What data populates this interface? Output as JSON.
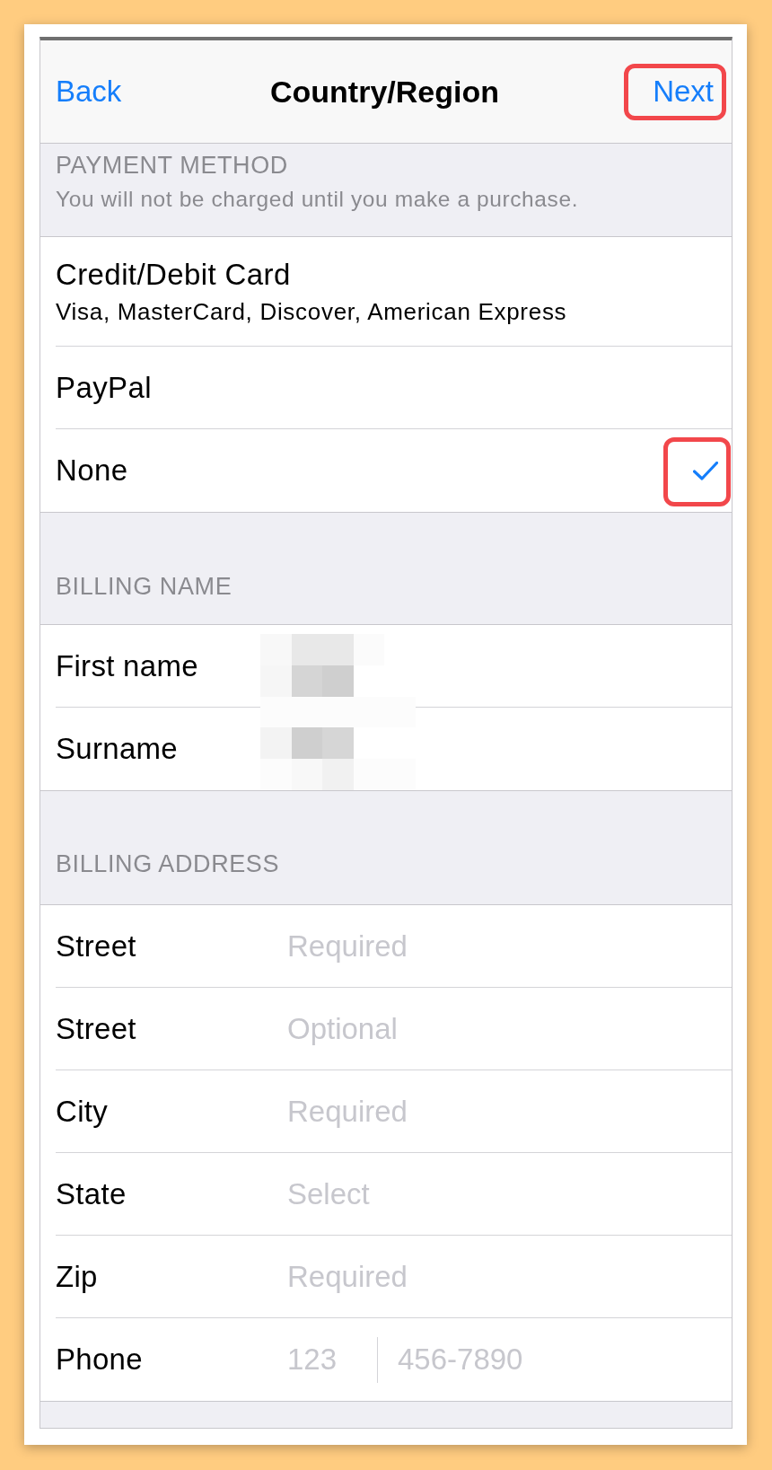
{
  "nav_bar": {
    "back": "Back",
    "title": "Country/Region",
    "next": {
      "label": "Next",
      "highlighted": true
    }
  },
  "payment_method": {
    "header": "PAYMENT METHOD",
    "note": "You will not be charged until you make a purchase.",
    "options": [
      {
        "label": "Credit/Debit Card",
        "detail": "Visa, MasterCard, Discover, American Express",
        "selected": false,
        "highlighted": false
      },
      {
        "label": "PayPal",
        "selected": false,
        "highlighted": false
      },
      {
        "label": "None",
        "selected": true,
        "highlighted": true
      }
    ]
  },
  "billing_name": {
    "header": "BILLING NAME",
    "redacted": true,
    "fields": [
      {
        "label": "First name"
      },
      {
        "label": "Surname"
      }
    ]
  },
  "billing_address": {
    "header": "BILLING ADDRESS",
    "fields": [
      {
        "kind": "text",
        "label": "Street",
        "placeholder": "Required"
      },
      {
        "kind": "text",
        "label": "Street",
        "placeholder": "Optional"
      },
      {
        "kind": "text",
        "label": "City",
        "placeholder": "Required"
      },
      {
        "kind": "text",
        "label": "State",
        "placeholder": "Select"
      },
      {
        "kind": "text",
        "label": "Zip",
        "placeholder": "Required"
      },
      {
        "kind": "phone",
        "label": "Phone",
        "placeholder": "123",
        "number_placeholder": "456-7890"
      }
    ]
  }
}
